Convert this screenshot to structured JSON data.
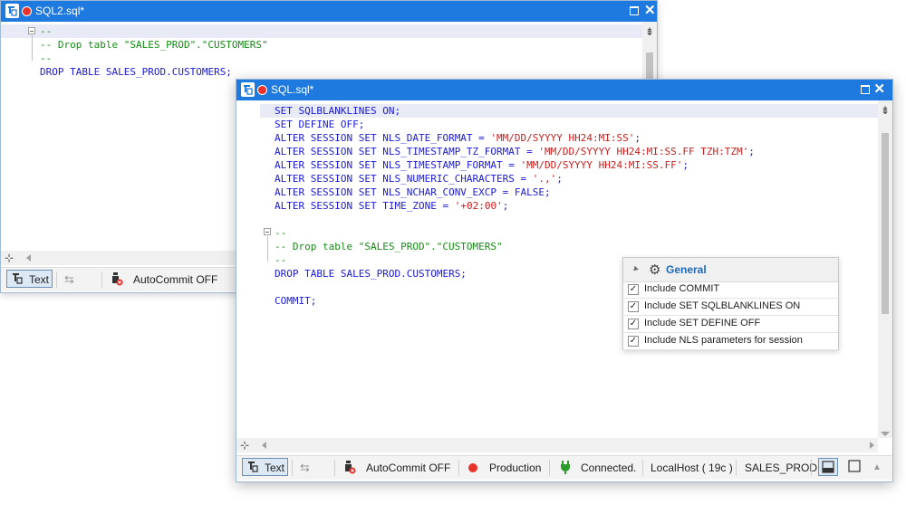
{
  "back_window": {
    "title": "SQL2.sql*",
    "code": [
      [
        {
          "t": "--",
          "c": "cm"
        }
      ],
      [
        {
          "t": "-- Drop table \"SALES_PROD\".\"CUSTOMERS\"",
          "c": "cm"
        }
      ],
      [
        {
          "t": "--",
          "c": "cm"
        }
      ],
      [
        {
          "t": "DROP TABLE ",
          "c": "kw"
        },
        {
          "t": "SALES_PROD.CUSTOMERS;",
          "c": "kw"
        }
      ]
    ],
    "status": {
      "text_label": "Text",
      "autocommit_label": "AutoCommit OFF"
    }
  },
  "front_window": {
    "title": "SQL.sql*",
    "code": [
      [
        {
          "t": "SET SQLBLANKLINES ON;",
          "c": "kw"
        }
      ],
      [
        {
          "t": "SET DEFINE OFF;",
          "c": "kw"
        }
      ],
      [
        {
          "t": "ALTER SESSION SET ",
          "c": "kw"
        },
        {
          "t": "NLS_DATE_FORMAT = ",
          "c": "kw"
        },
        {
          "t": "'MM/DD/SYYYY HH24:MI:SS'",
          "c": "str"
        },
        {
          "t": ";",
          "c": "kw"
        }
      ],
      [
        {
          "t": "ALTER SESSION SET ",
          "c": "kw"
        },
        {
          "t": "NLS_TIMESTAMP_TZ_FORMAT = ",
          "c": "kw"
        },
        {
          "t": "'MM/DD/SYYYY HH24:MI:SS.FF TZH:TZM'",
          "c": "str"
        },
        {
          "t": ";",
          "c": "kw"
        }
      ],
      [
        {
          "t": "ALTER SESSION SET ",
          "c": "kw"
        },
        {
          "t": "NLS_TIMESTAMP_FORMAT = ",
          "c": "kw"
        },
        {
          "t": "'MM/DD/SYYYY HH24:MI:SS.FF'",
          "c": "str"
        },
        {
          "t": ";",
          "c": "kw"
        }
      ],
      [
        {
          "t": "ALTER SESSION SET ",
          "c": "kw"
        },
        {
          "t": "NLS_NUMERIC_CHARACTERS = ",
          "c": "kw"
        },
        {
          "t": "'.,'",
          "c": "str"
        },
        {
          "t": ";",
          "c": "kw"
        }
      ],
      [
        {
          "t": "ALTER SESSION SET ",
          "c": "kw"
        },
        {
          "t": "NLS_NCHAR_CONV_EXCP = FALSE;",
          "c": "kw"
        }
      ],
      [
        {
          "t": "ALTER SESSION SET ",
          "c": "kw"
        },
        {
          "t": "TIME_ZONE = ",
          "c": "kw"
        },
        {
          "t": "'+02:00'",
          "c": "str"
        },
        {
          "t": ";",
          "c": "kw"
        }
      ],
      [],
      [
        {
          "t": "--",
          "c": "cm"
        }
      ],
      [
        {
          "t": "-- Drop table \"SALES_PROD\".\"CUSTOMERS\"",
          "c": "cm"
        }
      ],
      [
        {
          "t": "--",
          "c": "cm"
        }
      ],
      [
        {
          "t": "DROP TABLE ",
          "c": "kw"
        },
        {
          "t": "SALES_PROD.CUSTOMERS;",
          "c": "kw"
        }
      ],
      [],
      [
        {
          "t": "COMMIT;",
          "c": "kw"
        }
      ]
    ],
    "status": {
      "text_label": "Text",
      "autocommit_label": "AutoCommit OFF",
      "environment_label": "Production",
      "connection_label": "Connected.",
      "host_label": "LocalHost ( 19c )",
      "schema_label": "SALES_PROD"
    }
  },
  "options_popup": {
    "header": "General",
    "options": [
      {
        "label": "Include COMMIT",
        "checked": true
      },
      {
        "label": "Include SET SQLBLANKLINES ON",
        "checked": true
      },
      {
        "label": "Include SET DEFINE OFF",
        "checked": true
      },
      {
        "label": "Include NLS parameters for session",
        "checked": true
      }
    ]
  },
  "colors": {
    "titlebar": "#1f7ae0",
    "keyword": "#1a1ad6",
    "string": "#c81e1e",
    "comment": "#148c14",
    "accent_header": "#1f6ab8",
    "environment_dot": "#e8322c"
  }
}
